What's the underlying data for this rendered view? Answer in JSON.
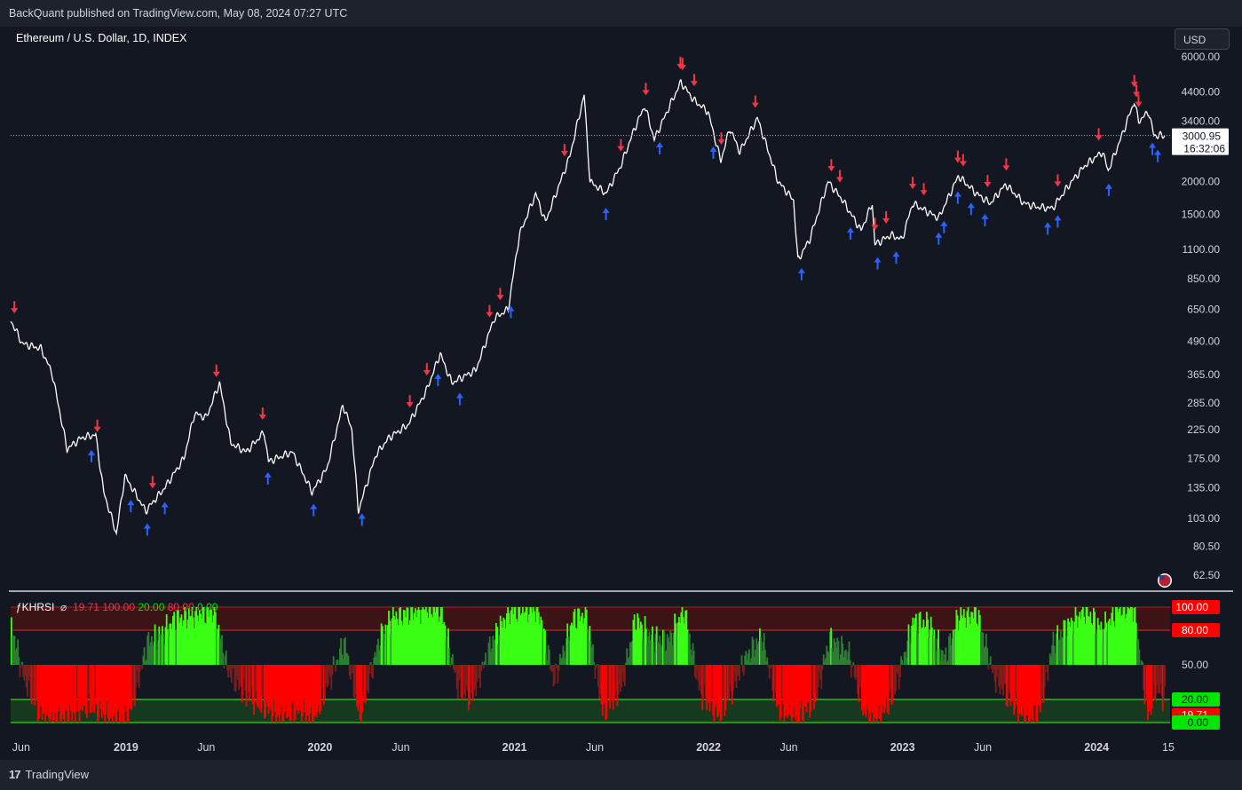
{
  "header": {
    "published": "BackQuant published on TradingView.com, May 08, 2024 07:27 UTC"
  },
  "symbol": {
    "title": "Ethereum / U.S. Dollar, 1D, INDEX"
  },
  "currency_button": "USD",
  "price_label": {
    "price": "3000.95",
    "countdown": "16:32:06"
  },
  "indicator": {
    "name": "ƒKHRSI",
    "settings_glyph": "⌀",
    "values": [
      "19.71",
      "100.00",
      "20.00",
      "80.00",
      "0.00"
    ]
  },
  "indicator_axis": {
    "ticks": [
      "100.00",
      "80.00",
      "50.00",
      "20.00",
      "19.71",
      "0.00"
    ]
  },
  "footer": {
    "brand": "TradingView"
  },
  "colors": {
    "background": "#131722",
    "price": "#ffffff",
    "buy": "#2962ff",
    "sell": "#f23645",
    "overbought": "#39ff14",
    "oversold": "#ff0000"
  },
  "chart_data": [
    {
      "type": "line",
      "title": "Ethereum / U.S. Dollar, 1D, INDEX",
      "y_scale": "log",
      "y_ticks": [
        6000,
        4400,
        3400,
        2000,
        1500,
        1100,
        850,
        650,
        490,
        365,
        285,
        225,
        175,
        135,
        103,
        80.5,
        62.5
      ],
      "y_tick_labels": [
        "6000.00",
        "4400.00",
        "3400.00",
        "2000.00",
        "1500.00",
        "1100.00",
        "850.00",
        "650.00",
        "490.00",
        "365.00",
        "285.00",
        "225.00",
        "175.00",
        "135.00",
        "103.00",
        "80.50",
        "62.50"
      ],
      "x_tick_labels": [
        "Jun",
        "2019",
        "Jun",
        "2020",
        "Jun",
        "2021",
        "Jun",
        "2022",
        "Jun",
        "2023",
        "Jun",
        "2024",
        "15"
      ],
      "x_tick_dates": [
        "2018-06-01",
        "2019-01-01",
        "2019-06-01",
        "2020-01-01",
        "2020-06-01",
        "2021-01-01",
        "2021-06-01",
        "2022-01-01",
        "2022-06-01",
        "2023-01-01",
        "2023-06-01",
        "2024-01-01",
        "2024-05-15"
      ],
      "x_range": [
        "2018-05-29",
        "2024-05-15"
      ],
      "last_price": 3000.95,
      "series": [
        {
          "x": [
            "2018-05-29",
            "2018-06-20",
            "2018-07-25",
            "2018-08-15",
            "2018-09-12",
            "2018-10-10",
            "2018-11-05",
            "2018-11-20",
            "2018-12-14",
            "2018-12-30",
            "2019-02-07",
            "2019-03-15",
            "2019-04-20",
            "2019-05-10",
            "2019-06-01",
            "2019-06-26",
            "2019-07-17",
            "2019-08-15",
            "2019-09-18",
            "2019-09-26",
            "2019-11-10",
            "2019-12-17",
            "2020-01-14",
            "2020-02-13",
            "2020-03-01",
            "2020-03-13",
            "2020-04-15",
            "2020-05-10",
            "2020-06-15",
            "2020-07-20",
            "2020-08-14",
            "2020-09-05",
            "2020-10-20",
            "2020-11-24",
            "2020-12-20",
            "2021-01-10",
            "2021-02-10",
            "2021-02-28",
            "2021-04-15",
            "2021-05-12",
            "2021-05-23",
            "2021-06-22",
            "2021-07-20",
            "2021-08-15",
            "2021-09-03",
            "2021-09-21",
            "2021-10-20",
            "2021-11-10",
            "2021-12-04",
            "2021-12-31",
            "2022-01-24",
            "2022-02-10",
            "2022-03-01",
            "2022-04-03",
            "2022-05-12",
            "2022-06-10",
            "2022-06-18",
            "2022-07-10",
            "2022-08-14",
            "2022-09-10",
            "2022-10-15",
            "2022-11-05",
            "2022-11-10",
            "2022-12-10",
            "2022-12-31",
            "2023-01-20",
            "2023-03-10",
            "2023-04-16",
            "2023-05-20",
            "2023-06-15",
            "2023-07-14",
            "2023-08-18",
            "2023-09-11",
            "2023-10-10",
            "2023-11-15",
            "2023-12-10",
            "2024-01-12",
            "2024-01-23",
            "2024-02-15",
            "2024-03-12",
            "2024-03-20",
            "2024-04-08",
            "2024-04-18",
            "2024-05-08"
          ],
          "y": [
            590,
            480,
            460,
            370,
            190,
            210,
            215,
            130,
            90,
            150,
            110,
            135,
            175,
            260,
            250,
            340,
            200,
            185,
            220,
            170,
            185,
            130,
            160,
            280,
            225,
            110,
            180,
            210,
            235,
            320,
            440,
            340,
            380,
            600,
            650,
            1250,
            1800,
            1400,
            2500,
            4300,
            2000,
            1800,
            2300,
            3200,
            3900,
            2900,
            3900,
            4800,
            4100,
            3700,
            2400,
            3200,
            2600,
            3500,
            2000,
            1700,
            1000,
            1200,
            2000,
            1700,
            1300,
            1650,
            1150,
            1250,
            1200,
            1650,
            1450,
            2100,
            1800,
            1650,
            1950,
            1650,
            1600,
            1580,
            2000,
            2300,
            2600,
            2200,
            2900,
            4050,
            3400,
            3700,
            3000,
            3000
          ]
        }
      ],
      "signals": {
        "sell_dates": [
          "2018-06-05",
          "2018-11-08",
          "2019-02-20",
          "2019-06-20",
          "2019-09-15",
          "2020-06-18",
          "2020-07-20",
          "2020-11-15",
          "2020-12-05",
          "2021-04-05",
          "2021-07-20",
          "2021-09-05",
          "2021-11-09",
          "2021-11-13",
          "2021-12-05",
          "2022-01-25",
          "2022-03-30",
          "2022-08-20",
          "2022-09-05",
          "2022-11-10",
          "2022-12-01",
          "2023-01-20",
          "2023-02-10",
          "2023-04-15",
          "2023-04-25",
          "2023-06-10",
          "2023-07-15",
          "2023-10-20",
          "2024-01-05",
          "2024-03-12",
          "2024-03-16",
          "2024-03-20"
        ],
        "buy_dates": [
          "2018-10-28",
          "2019-01-10",
          "2019-02-10",
          "2019-03-15",
          "2019-09-25",
          "2019-12-20",
          "2020-03-20",
          "2020-08-10",
          "2020-09-20",
          "2020-12-25",
          "2021-06-22",
          "2021-10-01",
          "2022-01-10",
          "2022-06-25",
          "2022-09-25",
          "2022-11-15",
          "2022-12-20",
          "2023-03-10",
          "2023-03-20",
          "2023-04-15",
          "2023-05-10",
          "2023-06-05",
          "2023-10-01",
          "2023-10-20",
          "2024-01-24",
          "2024-04-15",
          "2024-04-25"
        ]
      }
    },
    {
      "type": "area",
      "title": "ƒKHRSI",
      "y_range": [
        0,
        100
      ],
      "y_ticks": [
        100,
        80,
        50,
        20,
        0
      ],
      "levels": {
        "overbought": 80,
        "midline": 50,
        "oversold": 20
      },
      "last_value": 19.71,
      "series": [
        {
          "x": [
            "2018-05-29",
            "2018-06-20",
            "2018-07-20",
            "2018-08-15",
            "2018-09-15",
            "2018-10-20",
            "2018-11-15",
            "2018-12-05",
            "2019-01-05",
            "2019-02-10",
            "2019-03-10",
            "2019-04-05",
            "2019-04-20",
            "2019-05-20",
            "2019-06-15",
            "2019-07-10",
            "2019-08-10",
            "2019-09-10",
            "2019-10-15",
            "2019-11-20",
            "2019-12-20",
            "2020-01-20",
            "2020-02-15",
            "2020-03-15",
            "2020-04-20",
            "2020-05-15",
            "2020-06-15",
            "2020-07-20",
            "2020-08-15",
            "2020-09-15",
            "2020-10-10",
            "2020-11-20",
            "2020-12-20",
            "2021-01-20",
            "2021-02-15",
            "2021-03-15",
            "2021-04-20",
            "2021-05-15",
            "2021-06-15",
            "2021-07-20",
            "2021-08-15",
            "2021-09-10",
            "2021-10-15",
            "2021-11-15",
            "2021-12-15",
            "2022-01-20",
            "2022-02-15",
            "2022-03-10",
            "2022-04-10",
            "2022-05-10",
            "2022-06-15",
            "2022-07-20",
            "2022-08-15",
            "2022-09-20",
            "2022-10-20",
            "2022-11-15",
            "2022-12-15",
            "2023-01-20",
            "2023-02-20",
            "2023-03-20",
            "2023-04-15",
            "2023-05-20",
            "2023-06-20",
            "2023-07-20",
            "2023-08-20",
            "2023-09-15",
            "2023-10-10",
            "2023-11-10",
            "2023-12-10",
            "2024-01-10",
            "2024-02-10",
            "2024-03-10",
            "2024-04-05",
            "2024-04-20",
            "2024-05-08"
          ],
          "y": [
            85,
            40,
            10,
            2,
            5,
            15,
            8,
            2,
            5,
            70,
            78,
            90,
            92,
            95,
            96,
            45,
            25,
            15,
            4,
            10,
            2,
            40,
            70,
            2,
            72,
            92,
            95,
            100,
            98,
            30,
            20,
            72,
            96,
            99,
            97,
            35,
            90,
            94,
            8,
            30,
            90,
            75,
            70,
            98,
            25,
            5,
            30,
            55,
            75,
            12,
            3,
            20,
            72,
            60,
            8,
            2,
            25,
            88,
            85,
            55,
            92,
            95,
            40,
            20,
            2,
            10,
            70,
            85,
            98,
            80,
            99,
            100,
            5,
            30,
            19.71
          ]
        }
      ]
    }
  ]
}
